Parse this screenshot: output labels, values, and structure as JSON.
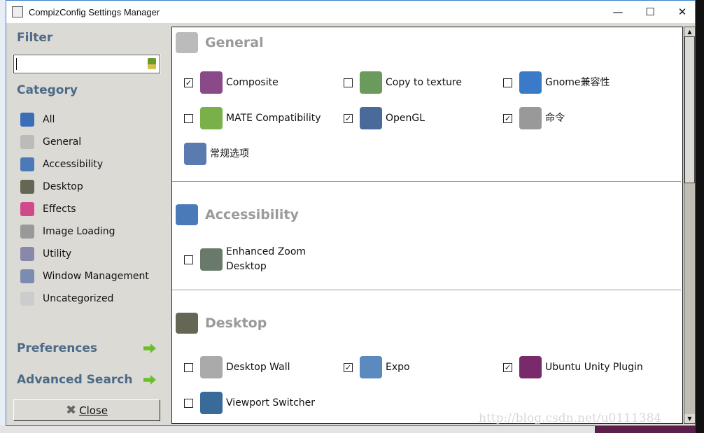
{
  "window": {
    "title": "CompizConfig Settings Manager",
    "minimize": "—",
    "maximize": "☐",
    "close": "✕"
  },
  "sidebar": {
    "filter_label": "Filter",
    "filter_value": "",
    "category_label": "Category",
    "categories": [
      {
        "label": "All",
        "icon": "globe-icon",
        "color": "#3a6fb8"
      },
      {
        "label": "General",
        "icon": "gear-icon",
        "color": "#bbbbbb"
      },
      {
        "label": "Accessibility",
        "icon": "accessibility-icon",
        "color": "#4a7ab8"
      },
      {
        "label": "Desktop",
        "icon": "desktop-icon",
        "color": "#666655"
      },
      {
        "label": "Effects",
        "icon": "effects-icon",
        "color": "#d04a8a"
      },
      {
        "label": "Image Loading",
        "icon": "image-loading-icon",
        "color": "#999999"
      },
      {
        "label": "Utility",
        "icon": "utility-icon",
        "color": "#8888aa"
      },
      {
        "label": "Window Management",
        "icon": "window-management-icon",
        "color": "#7a8cb0"
      },
      {
        "label": "Uncategorized",
        "icon": "question-icon",
        "color": "#cccccc"
      }
    ],
    "preferences": "Preferences",
    "advanced_search": "Advanced Search",
    "close_button": "Close"
  },
  "sections": [
    {
      "title": "General",
      "icon": "gear-icon",
      "plugins": [
        {
          "label": "Composite",
          "checked": true,
          "color": "#8a4a8a"
        },
        {
          "label": "Copy to texture",
          "checked": false,
          "color": "#6a9b5a"
        },
        {
          "label": "Gnome兼容性",
          "checked": false,
          "color": "#3a7ac8"
        },
        {
          "label": "MATE Compatibility",
          "checked": false,
          "color": "#7ab04a"
        },
        {
          "label": "OpenGL",
          "checked": true,
          "color": "#4a6a9a"
        },
        {
          "label": "命令",
          "checked": true,
          "color": "#999999"
        },
        {
          "label": "常规选项",
          "checked": null,
          "color": "#5a7ab0"
        }
      ]
    },
    {
      "title": "Accessibility",
      "icon": "accessibility-icon",
      "plugins": [
        {
          "label": "Enhanced Zoom Desktop",
          "checked": false,
          "color": "#6a7a6a"
        }
      ]
    },
    {
      "title": "Desktop",
      "icon": "desktop-icon",
      "plugins": [
        {
          "label": "Desktop Wall",
          "checked": false,
          "color": "#aaaaaa"
        },
        {
          "label": "Expo",
          "checked": true,
          "color": "#5a8ac0"
        },
        {
          "label": "Ubuntu Unity Plugin",
          "checked": true,
          "color": "#7a2a6a"
        },
        {
          "label": "Viewport Switcher",
          "checked": false,
          "color": "#3a6a9a"
        }
      ]
    }
  ],
  "watermark": "http://blog.csdn.net/u0111384"
}
